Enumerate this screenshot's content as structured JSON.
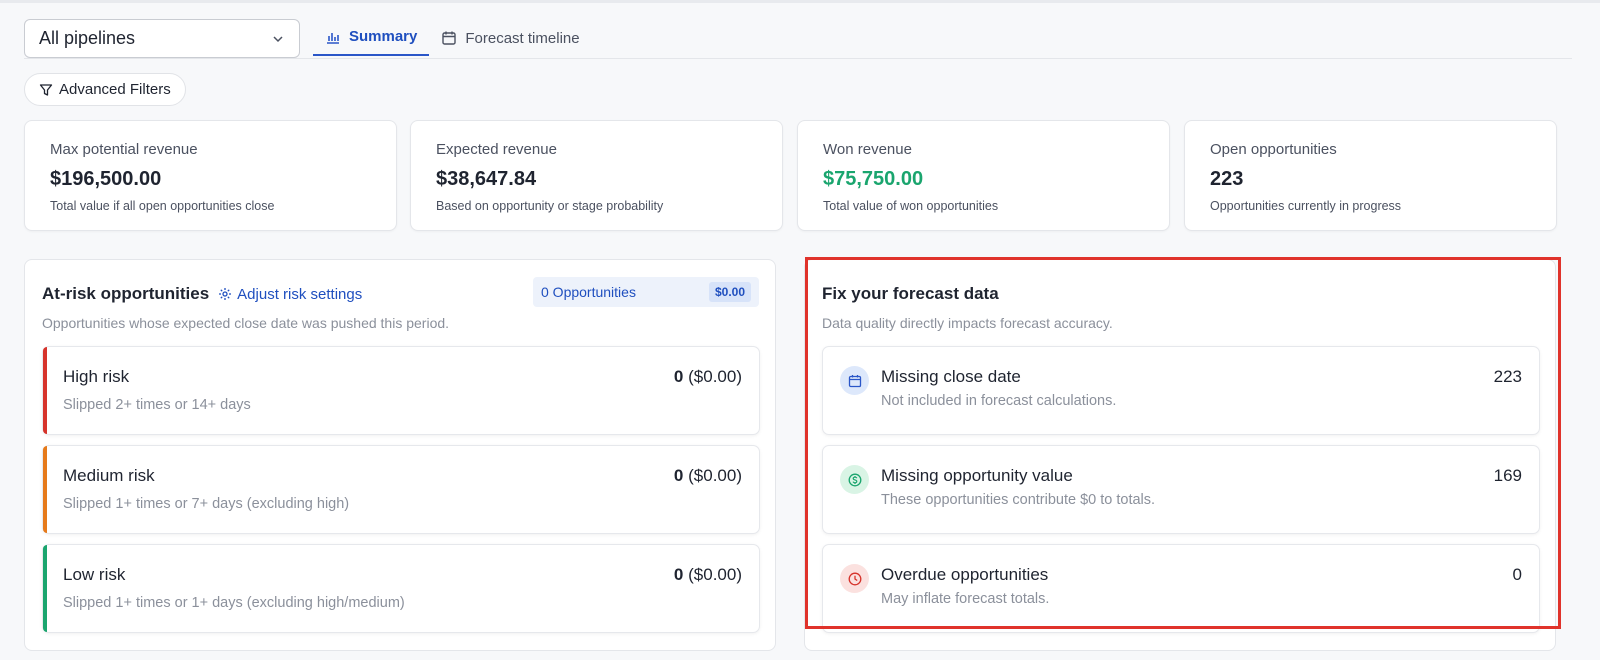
{
  "toolbar": {
    "pipeline_select": "All pipelines",
    "tabs": [
      {
        "label": "Summary",
        "icon": "bar-chart-icon",
        "active": true
      },
      {
        "label": "Forecast timeline",
        "icon": "calendar-icon",
        "active": false
      }
    ],
    "filters_label": "Advanced Filters"
  },
  "kpis": [
    {
      "label": "Max potential revenue",
      "value": "$196,500.00",
      "sub": "Total value if all open opportunities close"
    },
    {
      "label": "Expected revenue",
      "value": "$38,647.84",
      "sub": "Based on opportunity or stage probability"
    },
    {
      "label": "Won revenue",
      "value": "$75,750.00",
      "sub": "Total value of won opportunities",
      "color": "#1aa56e"
    },
    {
      "label": "Open opportunities",
      "value": "223",
      "sub": "Opportunities currently in progress"
    }
  ],
  "at_risk": {
    "title": "At-risk opportunities",
    "adjust_label": "Adjust risk settings",
    "description": "Opportunities whose expected close date was pushed this period.",
    "chip_count": "0 Opportunities",
    "chip_amount": "$0.00",
    "rows": [
      {
        "title": "High risk",
        "sub": "Slipped 2+ times or 14+ days",
        "count": "0",
        "amount": "($0.00)",
        "color": "#d6332b"
      },
      {
        "title": "Medium risk",
        "sub": "Slipped 1+ times or 7+ days (excluding high)",
        "count": "0",
        "amount": "($0.00)",
        "color": "#e67a1a"
      },
      {
        "title": "Low risk",
        "sub": "Slipped 1+ times or 1+ days (excluding high/medium)",
        "count": "0",
        "amount": "($0.00)",
        "color": "#1aa56e"
      }
    ]
  },
  "fix_data": {
    "title": "Fix your forecast data",
    "description": "Data quality directly impacts forecast accuracy.",
    "rows": [
      {
        "title": "Missing close date",
        "sub": "Not included in forecast calculations.",
        "value": "223",
        "icon": "calendar-icon",
        "bg": "#dde8fb",
        "fg": "#2a56c8"
      },
      {
        "title": "Missing opportunity value",
        "sub": "These opportunities contribute $0 to totals.",
        "value": "169",
        "icon": "dollar-icon",
        "bg": "#d9f4e5",
        "fg": "#1aa56e"
      },
      {
        "title": "Overdue opportunities",
        "sub": "May inflate forecast totals.",
        "value": "0",
        "icon": "clock-icon",
        "bg": "#fbe1df",
        "fg": "#d6332b"
      }
    ]
  }
}
